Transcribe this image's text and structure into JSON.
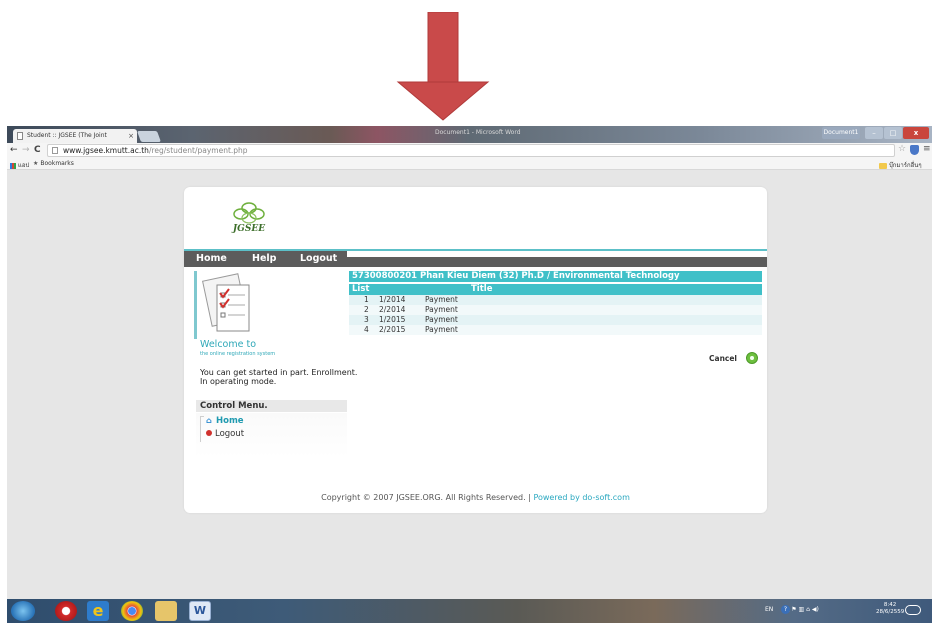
{
  "browser": {
    "tab_title": "Student :: JGSEE (The Joint",
    "tab_close": "×",
    "taskbar_window_title": "Document1 - Microsoft Word",
    "user_label": "Document1",
    "min_glyph": "–",
    "max_glyph": "□",
    "close_glyph": "x",
    "back_glyph": "←",
    "forward_glyph": "→",
    "reload_glyph": "C",
    "url_host": "www.jgsee.kmutt.ac.th",
    "url_path": "/reg/student/payment.php",
    "star_glyph": "☆",
    "menu_glyph": "≡",
    "bookmarks": {
      "apps_label": "แอป",
      "bookmarks_label": "Bookmarks",
      "star_glyph": "★",
      "other_label": "บุ๊กมาร์กอื่นๆ"
    }
  },
  "page": {
    "logo_text": "JGSEE",
    "nav": {
      "home": "Home",
      "help": "Help",
      "logout": "Logout"
    },
    "welcome": "Welcome to",
    "welcome_sub": "the online registration system",
    "started_text": "You can get started in part. Enrollment. In operating mode.",
    "control_menu": {
      "title": "Control Menu.",
      "home_glyph": "⌂",
      "home": "Home",
      "logout": "Logout"
    },
    "student_header": "57300800201 Phan Kieu Diem (32) Ph.D / Environmental Technology",
    "table": {
      "headers": [
        "List",
        "Title"
      ],
      "rows": [
        {
          "no": "1",
          "term": "1/2014",
          "title": "Payment"
        },
        {
          "no": "2",
          "term": "2/2014",
          "title": "Payment"
        },
        {
          "no": "3",
          "term": "1/2015",
          "title": "Payment"
        },
        {
          "no": "4",
          "term": "2/2015",
          "title": "Payment"
        }
      ]
    },
    "cancel_label": "Cancel",
    "footer": {
      "copyright": "Copyright © 2007 JGSEE.ORG. All Rights Reserved. | ",
      "powered": "Powered by do-soft.com"
    }
  },
  "taskbar": {
    "ie_glyph": "e",
    "word_glyph": "W",
    "tray_lang": "EN",
    "tray_help": "?",
    "tray_icons": "▲  ⚑  ▥  ⌂  ◀)",
    "time": "8:42",
    "date": "28/6/2559"
  },
  "colors": {
    "accent_teal": "#40c0c8",
    "nav_gray": "#5c5c5c",
    "arrow_red": "#c94a4a"
  }
}
